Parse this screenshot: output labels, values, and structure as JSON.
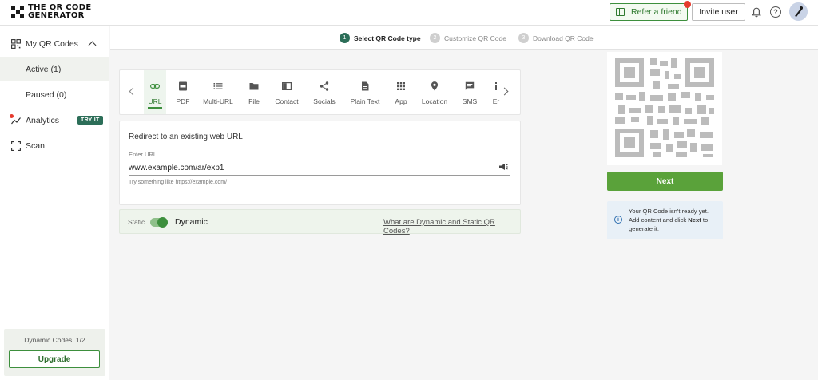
{
  "header": {
    "logo_line1": "THE QR CODE",
    "logo_line2": "GENERATOR",
    "refer_label": "Refer a friend",
    "invite_label": "Invite user"
  },
  "sidebar": {
    "items": [
      {
        "label": "My QR Codes",
        "icon": "qr-grid-icon"
      },
      {
        "label": "Active (1)"
      },
      {
        "label": "Paused (0)"
      },
      {
        "label": "Analytics",
        "icon": "chart-line-icon",
        "badge": "TRY IT"
      },
      {
        "label": "Scan",
        "icon": "scan-icon"
      }
    ],
    "dynamic_codes": "Dynamic Codes: 1/2",
    "upgrade_label": "Upgrade"
  },
  "stepper": {
    "steps": [
      {
        "num": "1",
        "label": "Select QR Code type"
      },
      {
        "num": "2",
        "label": "Customize QR Code"
      },
      {
        "num": "3",
        "label": "Download QR Code"
      }
    ]
  },
  "types": [
    {
      "label": "URL",
      "icon": "link-icon"
    },
    {
      "label": "PDF",
      "icon": "pdf-icon"
    },
    {
      "label": "Multi-URL",
      "icon": "list-icon"
    },
    {
      "label": "File",
      "icon": "folder-icon"
    },
    {
      "label": "Contact",
      "icon": "contact-card-icon"
    },
    {
      "label": "Socials",
      "icon": "share-icon"
    },
    {
      "label": "Plain Text",
      "icon": "document-icon"
    },
    {
      "label": "App",
      "icon": "app-grid-icon"
    },
    {
      "label": "Location",
      "icon": "location-pin-icon"
    },
    {
      "label": "SMS",
      "icon": "message-icon"
    },
    {
      "label": "Er",
      "icon": "info-icon"
    }
  ],
  "url_form": {
    "title": "Redirect to an existing web URL",
    "field_label": "Enter URL",
    "value": "www.example.com/ar/exp1",
    "hint": "Try something like https://example.com/"
  },
  "mode": {
    "static_label": "Static",
    "dynamic_label": "Dynamic",
    "link": "What are Dynamic and Static QR Codes?"
  },
  "right_panel": {
    "next_label": "Next",
    "info_line1": "Your QR Code isn't ready yet.",
    "info_line2_pre": "Add content and click ",
    "info_line2_bold": "Next",
    "info_line2_post": " to",
    "info_line3": "generate it."
  },
  "colors": {
    "brand_green": "#3d8f3d",
    "next_green": "#5aa23a",
    "dark_teal": "#2c6e58",
    "alert_red": "#e63b2e"
  }
}
